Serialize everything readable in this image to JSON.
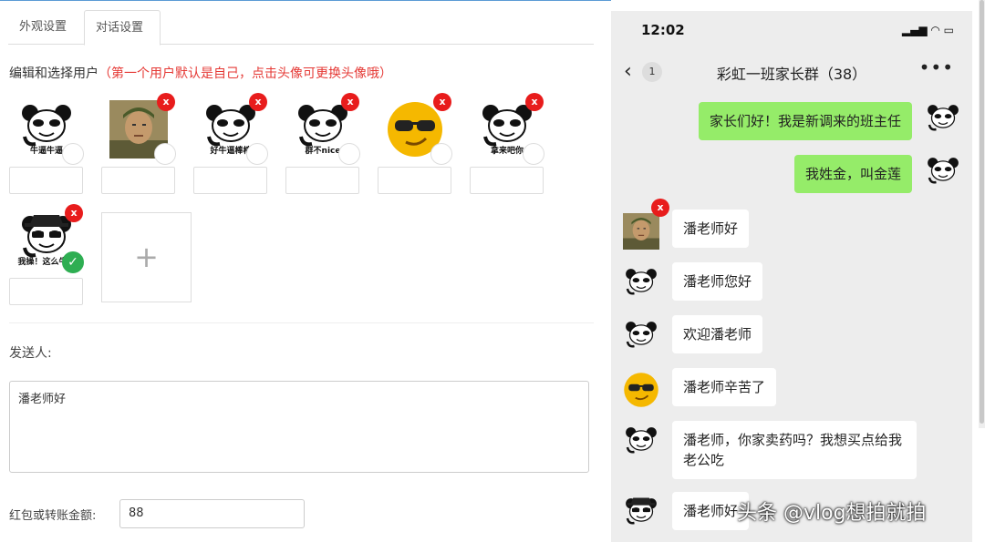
{
  "tabs": [
    {
      "label": "外观设置"
    },
    {
      "label": "对话设置"
    }
  ],
  "hint": {
    "main": "编辑和选择用户",
    "note": "（第一个用户默认是自己，点击头像可更换头像哦）"
  },
  "users": [
    {
      "caption": "牛逼牛逼",
      "removable": false,
      "selected": false,
      "kind": "panda"
    },
    {
      "caption": "",
      "removable": true,
      "selected": false,
      "kind": "soldier"
    },
    {
      "caption": "好牛逼棒棒",
      "removable": true,
      "selected": false,
      "kind": "panda"
    },
    {
      "caption": "群不nice",
      "removable": true,
      "selected": false,
      "kind": "panda"
    },
    {
      "caption": "",
      "removable": true,
      "selected": false,
      "kind": "sunglasses"
    },
    {
      "caption": "拿来吧你",
      "removable": true,
      "selected": false,
      "kind": "panda"
    },
    {
      "caption": "我操！这么牛逼",
      "removable": true,
      "selected": true,
      "kind": "panda-hat"
    }
  ],
  "remove_glyph": "x",
  "check_glyph": "✓",
  "add_glyph": "+",
  "sender_label": "发送人:",
  "message_text": "潘老师好",
  "amount_label": "红包或转账金额:",
  "amount_value": "88",
  "phone": {
    "time": "12:02",
    "status_icons": "▂▄▆ ◠ ▭",
    "back": "‹",
    "unread": "1",
    "group_title": "彩虹一班家长群（38）",
    "more": "•••"
  },
  "messages": [
    {
      "text": "家长们好！我是新调来的班主任",
      "me": true
    },
    {
      "text": "我姓金，叫金莲",
      "me": true
    },
    {
      "text": "潘老师好",
      "me": false
    },
    {
      "text": "潘老师您好",
      "me": false
    },
    {
      "text": "欢迎潘老师",
      "me": false
    },
    {
      "text": "潘老师辛苦了",
      "me": false
    },
    {
      "text": "潘老师，你家卖药吗？我想买点给我老公吃",
      "me": false
    },
    {
      "text": "潘老师好",
      "me": false
    }
  ],
  "watermark": "头条 @vlog想拍就拍",
  "colors": {
    "accent_red": "#e53935",
    "bubble_green": "#95ec69",
    "check_green": "#2eae52",
    "phone_bg": "#ededed"
  }
}
